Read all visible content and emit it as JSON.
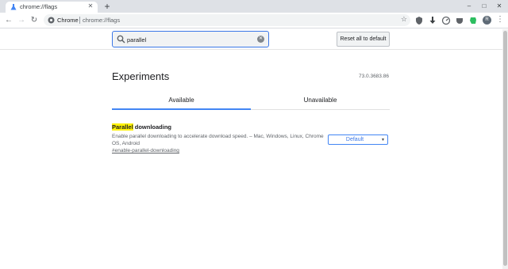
{
  "browser": {
    "tab": {
      "title": "chrome://flags",
      "close": "✕"
    },
    "new_tab": "+",
    "window": {
      "minimize": "–",
      "maximize": "□",
      "close": "✕"
    },
    "nav": {
      "back": "←",
      "forward": "→",
      "reload": "↻"
    },
    "omnibox": {
      "label": "Chrome",
      "url": "chrome://flags",
      "star": "☆"
    },
    "avatar_letter": "R",
    "menu": "⋮"
  },
  "flags": {
    "search": {
      "value": "parallel",
      "placeholder": "Search flags"
    },
    "reset_button": "Reset all to default",
    "title": "Experiments",
    "version": "73.0.3683.86",
    "tabs": [
      {
        "label": "Available"
      },
      {
        "label": "Unavailable"
      }
    ],
    "items": [
      {
        "name_highlight": "Parallel",
        "name_rest": " downloading",
        "description": "Enable parallel downloading to accelerate download speed. – Mac, Windows, Linux, Chrome OS, Android",
        "link": "#enable-parallel-downloading",
        "select_value": "Default"
      }
    ]
  },
  "colors": {
    "accent": "#4285f4",
    "highlight": "#fff200",
    "evernote": "#2dbe60"
  }
}
